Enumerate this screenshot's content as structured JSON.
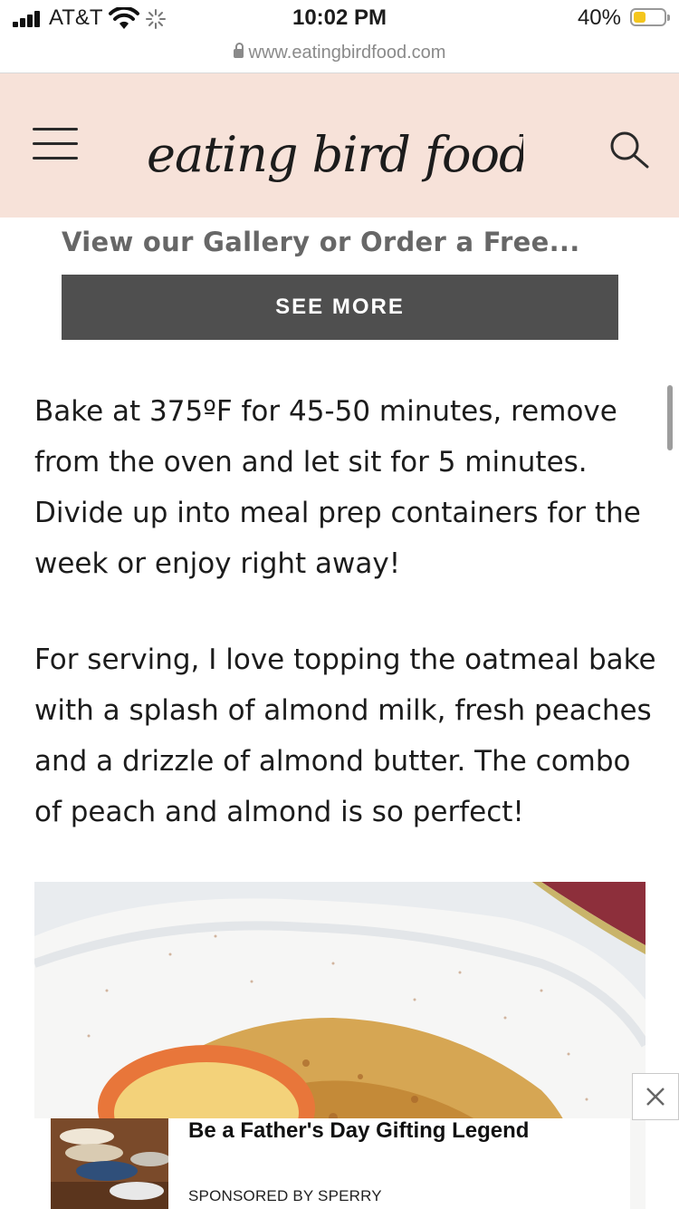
{
  "status_bar": {
    "carrier": "AT&T",
    "time": "10:02 PM",
    "battery_percent": "40%",
    "battery_color": "#f4c61d"
  },
  "browser": {
    "url": "www.eatingbirdfood.com"
  },
  "header": {
    "background": "#f7e2d9",
    "logo_text": "eating bird food",
    "menu_icon": "hamburger-menu-icon",
    "search_icon": "search-icon"
  },
  "teaser": {
    "text": "View our Gallery or Order a Free...",
    "button_label": "SEE MORE"
  },
  "article": {
    "paragraph_1": "Bake at 375ºF for 45-50 minutes, remove from the oven and let sit for 5 minutes. Divide up into meal prep containers for the week or enjoy right away!",
    "paragraph_2": "For serving, I love topping the oatmeal bake with a splash of almond milk, fresh peaches and a drizzle of almond butter. The combo of peach and almond is so perfect!"
  },
  "ad": {
    "title": "Be a Father's Day Gifting Legend",
    "sponsor": "SPONSORED BY SPERRY",
    "close_symbol": "✕"
  }
}
